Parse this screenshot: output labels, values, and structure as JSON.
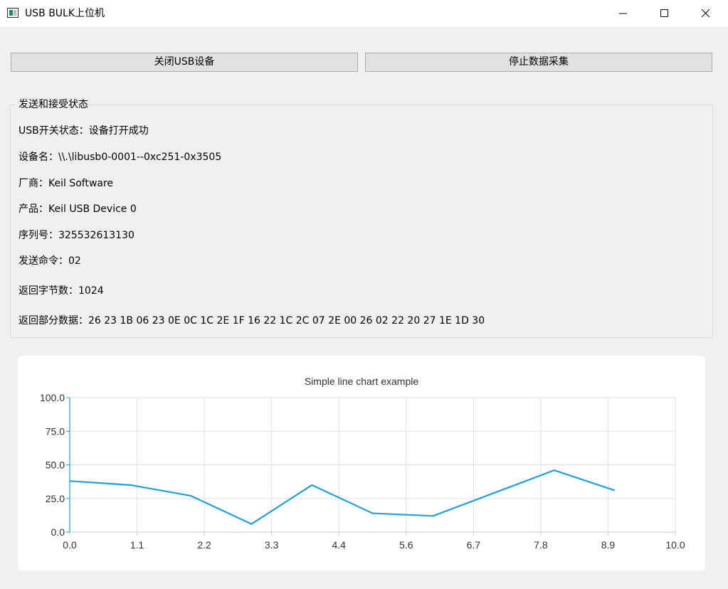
{
  "window": {
    "title": "USB BULK上位机",
    "controls": {
      "minimize": "minimize",
      "maximize": "maximize",
      "close": "close"
    }
  },
  "toolbar": {
    "close_usb_label": "关闭USB设备",
    "stop_collect_label": "停止数据采集"
  },
  "status_group": {
    "title": "发送和接受状态",
    "lines": [
      "USB开关状态：设备打开成功",
      "设备名：\\\\.\\libusb0-0001--0xc251-0x3505",
      "厂商：Keil Software",
      "产品：Keil USB Device 0",
      "序列号：325532613130",
      "发送命令：02",
      "返回字节数：1024",
      "返回部分数据：26 23 1B 06 23 0E 0C 1C 2E 1F 16 22 1C 2C 07 2E 00 26 02 22 20 27 1E 1D 30"
    ]
  },
  "chart_data": {
    "type": "line",
    "title": "Simple line chart example",
    "xlim": [
      0,
      10
    ],
    "ylim": [
      0,
      100
    ],
    "x_ticks": [
      "0.0",
      "1.1",
      "2.2",
      "3.3",
      "4.4",
      "5.6",
      "6.7",
      "7.8",
      "8.9",
      "10.0"
    ],
    "y_ticks": [
      "0.0",
      "25.0",
      "50.0",
      "75.0",
      "100.0"
    ],
    "grid": true,
    "series": [
      {
        "x": [
          0,
          1,
          2,
          3,
          4,
          5,
          6,
          7,
          8,
          9
        ],
        "y": [
          38,
          35,
          27,
          6,
          35,
          14,
          12,
          29,
          46,
          31
        ],
        "color": "#209fdf"
      }
    ]
  }
}
